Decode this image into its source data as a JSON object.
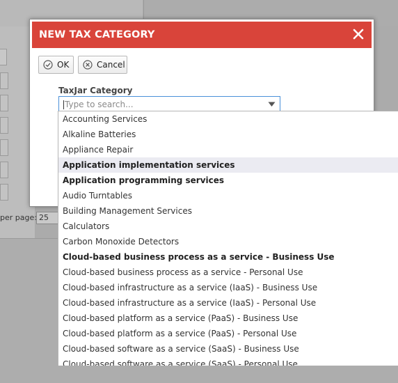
{
  "background": {
    "per_page_label": "per page:",
    "per_page_value": "25"
  },
  "dialog": {
    "title": "NEW TAX CATEGORY",
    "header_color": "#d9443a",
    "close_icon": "close-icon",
    "ok_label": "OK",
    "cancel_label": "Cancel",
    "field_label": "TaxJar Category",
    "search_placeholder": "Type to search..."
  },
  "dropdown": {
    "items": [
      {
        "label": "Accounting Services",
        "bold": false
      },
      {
        "label": "Alkaline Batteries",
        "bold": false
      },
      {
        "label": "Appliance Repair",
        "bold": false
      },
      {
        "label": "Application implementation services",
        "bold": true,
        "hovered": true
      },
      {
        "label": "Application programming services",
        "bold": true
      },
      {
        "label": "Audio Turntables",
        "bold": false
      },
      {
        "label": "Building Management Services",
        "bold": false
      },
      {
        "label": "Calculators",
        "bold": false
      },
      {
        "label": "Carbon Monoxide Detectors",
        "bold": false
      },
      {
        "label": "Cloud-based business process as a service - Business Use",
        "bold": true
      },
      {
        "label": "Cloud-based business process as a service - Personal Use",
        "bold": false
      },
      {
        "label": "Cloud-based infrastructure as a service (IaaS) - Business Use",
        "bold": false
      },
      {
        "label": "Cloud-based infrastructure as a service (IaaS) - Personal Use",
        "bold": false
      },
      {
        "label": "Cloud-based platform as a service (PaaS) - Business Use",
        "bold": false
      },
      {
        "label": "Cloud-based platform as a service (PaaS) - Personal Use",
        "bold": false
      },
      {
        "label": "Cloud-based software as a service (SaaS) - Business Use",
        "bold": false
      },
      {
        "label": "Cloud-based software as a service (SaaS) - Personal Use",
        "bold": false
      }
    ]
  }
}
